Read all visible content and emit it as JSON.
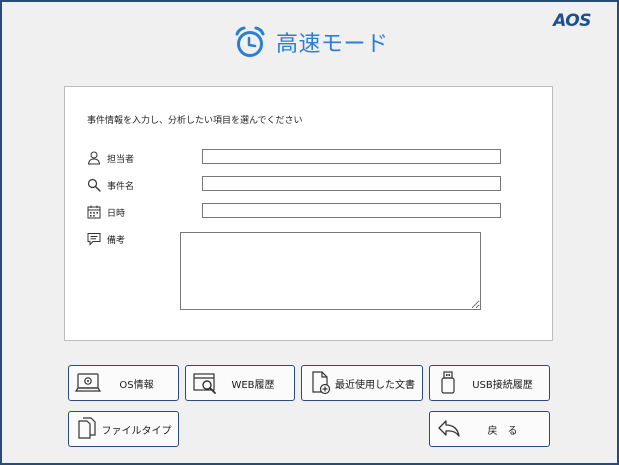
{
  "header": {
    "title": "高速モード",
    "brand": "AOS"
  },
  "form": {
    "instruction": "事件情報を入力し、分析したい項目を選んでください",
    "fields": [
      {
        "label": "担当者",
        "value": "",
        "icon": "person-icon"
      },
      {
        "label": "事件名",
        "value": "",
        "icon": "search-icon"
      },
      {
        "label": "日時",
        "value": "",
        "icon": "calendar-icon"
      },
      {
        "label": "備考",
        "value": "",
        "icon": "comment-icon"
      }
    ]
  },
  "buttons": {
    "os_info": {
      "label": "OS情報",
      "icon": "gear-monitor-icon"
    },
    "web_history": {
      "label": "WEB履歴",
      "icon": "browser-search-icon"
    },
    "recent_docs": {
      "label": "最近使用した文書",
      "icon": "document-add-icon"
    },
    "usb_history": {
      "label": "USB接続履歴",
      "icon": "usb-drive-icon"
    },
    "file_type": {
      "label": "ファイルタイプ",
      "icon": "files-icon"
    },
    "back": {
      "label": "戻　る",
      "icon": "back-arrow-icon"
    }
  },
  "colors": {
    "accent": "#2b7fd3",
    "border": "#2a4a78",
    "brand": "#1f4f8f",
    "background": "#f0f0f0"
  }
}
